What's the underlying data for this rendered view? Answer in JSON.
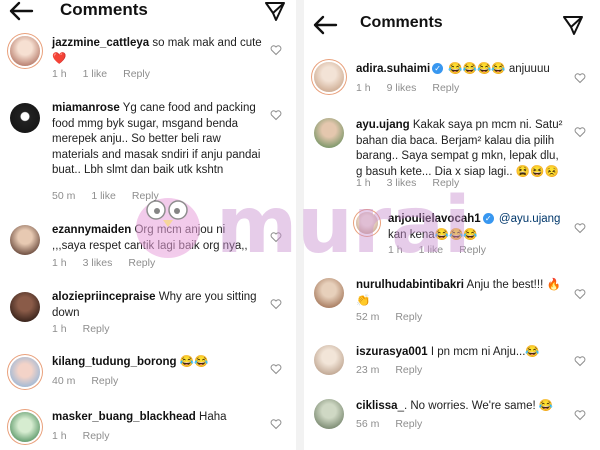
{
  "left": {
    "title": "Comments",
    "comments": [
      {
        "user": "jazzmine_cattleya",
        "text": "so mak mak and cute ❤️",
        "time": "1 h",
        "likes": "1 like",
        "reply": "Reply"
      },
      {
        "user": "miamanrose",
        "text": "Yg cane food and packing food mmg byk sugar, msgand benda merepek anju.. So better beli raw materials and masak sndiri if anju pandai buat.. Lbh slmt dan baik utk kshtn",
        "time": "50 m",
        "likes": "1 like",
        "reply": "Reply"
      },
      {
        "user": "ezannymaiden",
        "text": "Org mcm anjou ni ,,,saya respet cantik lagi baik org nya,,",
        "time": "1 h",
        "likes": "3 likes",
        "reply": "Reply"
      },
      {
        "user": "aloziepriincepraise",
        "text": "Why are you sitting down",
        "time": "1 h",
        "likes": "",
        "reply": "Reply"
      },
      {
        "user": "kilang_tudung_borong",
        "text": "😂😂",
        "time": "40 m",
        "likes": "",
        "reply": "Reply"
      },
      {
        "user": "masker_buang_blackhead",
        "text": "Haha",
        "time": "1 h",
        "likes": "",
        "reply": "Reply"
      }
    ]
  },
  "right": {
    "title": "Comments",
    "comments": [
      {
        "user": "adira.suhaimi",
        "text": "😂😂😂😂 anjuuuu",
        "time": "1 h",
        "likes": "9 likes",
        "reply": "Reply"
      },
      {
        "user": "ayu.ujang",
        "text": "Kakak saya pn mcm ni. Satu² bahan dia baca. Berjam² kalau dia pilih barang.. Saya sempat g mkn,  lepak dlu, g basuh kete... Dia x siap lagi.. 😫😆😣",
        "time": "1 h",
        "likes": "3 likes",
        "reply": "Reply"
      },
      {
        "user": "anjoulielavocah1",
        "mention": "@ayu.ujang",
        "text": "kan kena😂😂😂",
        "time": "1 h",
        "likes": "1 like",
        "reply": "Reply"
      },
      {
        "user": "nurulhudabintibakri",
        "text": "Anju the best!!! 🔥👏",
        "time": "52 m",
        "likes": "",
        "reply": "Reply"
      },
      {
        "user": "iszurasya001",
        "text": "I pn mcm ni Anju...😂",
        "time": "23 m",
        "likes": "",
        "reply": "Reply"
      },
      {
        "user": "ciklissa",
        "text": "_. No worries. We're same! 😂",
        "time": "56 m",
        "likes": "",
        "reply": "Reply"
      }
    ]
  },
  "watermark": {
    "text": "murai"
  },
  "colors": {
    "accent": "#3897f0",
    "meta": "#8e8e8e",
    "heart": "#ed4956",
    "watermark": "#c98fd0"
  },
  "icons": {
    "back": "arrow-left-icon",
    "send": "send-icon",
    "like": "heart-outline-icon",
    "verified": "verified-badge-icon"
  }
}
